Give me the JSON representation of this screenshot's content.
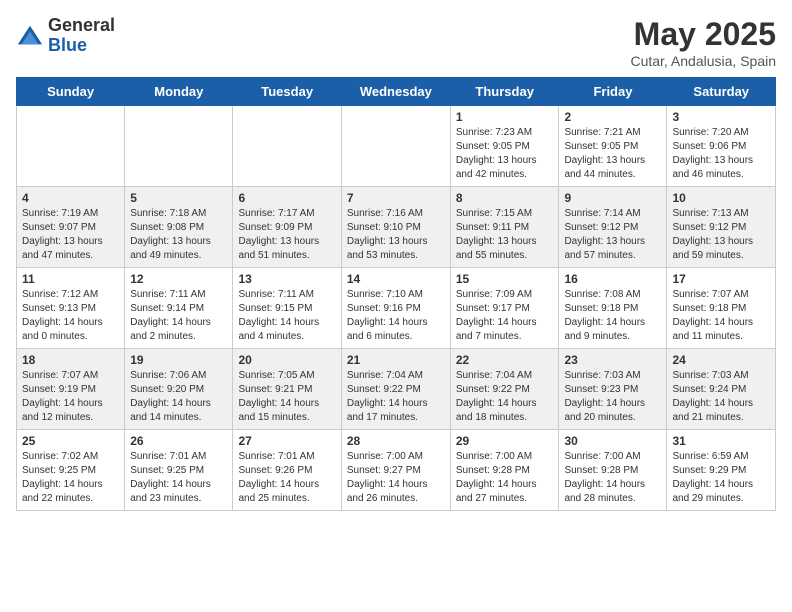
{
  "logo": {
    "general": "General",
    "blue": "Blue"
  },
  "title": {
    "month_year": "May 2025",
    "location": "Cutar, Andalusia, Spain"
  },
  "weekdays": [
    "Sunday",
    "Monday",
    "Tuesday",
    "Wednesday",
    "Thursday",
    "Friday",
    "Saturday"
  ],
  "weeks": [
    [
      {
        "day": "",
        "sunrise": "",
        "sunset": "",
        "daylight": ""
      },
      {
        "day": "",
        "sunrise": "",
        "sunset": "",
        "daylight": ""
      },
      {
        "day": "",
        "sunrise": "",
        "sunset": "",
        "daylight": ""
      },
      {
        "day": "",
        "sunrise": "",
        "sunset": "",
        "daylight": ""
      },
      {
        "day": "1",
        "sunrise": "Sunrise: 7:23 AM",
        "sunset": "Sunset: 9:05 PM",
        "daylight": "Daylight: 13 hours and 42 minutes."
      },
      {
        "day": "2",
        "sunrise": "Sunrise: 7:21 AM",
        "sunset": "Sunset: 9:05 PM",
        "daylight": "Daylight: 13 hours and 44 minutes."
      },
      {
        "day": "3",
        "sunrise": "Sunrise: 7:20 AM",
        "sunset": "Sunset: 9:06 PM",
        "daylight": "Daylight: 13 hours and 46 minutes."
      }
    ],
    [
      {
        "day": "4",
        "sunrise": "Sunrise: 7:19 AM",
        "sunset": "Sunset: 9:07 PM",
        "daylight": "Daylight: 13 hours and 47 minutes."
      },
      {
        "day": "5",
        "sunrise": "Sunrise: 7:18 AM",
        "sunset": "Sunset: 9:08 PM",
        "daylight": "Daylight: 13 hours and 49 minutes."
      },
      {
        "day": "6",
        "sunrise": "Sunrise: 7:17 AM",
        "sunset": "Sunset: 9:09 PM",
        "daylight": "Daylight: 13 hours and 51 minutes."
      },
      {
        "day": "7",
        "sunrise": "Sunrise: 7:16 AM",
        "sunset": "Sunset: 9:10 PM",
        "daylight": "Daylight: 13 hours and 53 minutes."
      },
      {
        "day": "8",
        "sunrise": "Sunrise: 7:15 AM",
        "sunset": "Sunset: 9:11 PM",
        "daylight": "Daylight: 13 hours and 55 minutes."
      },
      {
        "day": "9",
        "sunrise": "Sunrise: 7:14 AM",
        "sunset": "Sunset: 9:12 PM",
        "daylight": "Daylight: 13 hours and 57 minutes."
      },
      {
        "day": "10",
        "sunrise": "Sunrise: 7:13 AM",
        "sunset": "Sunset: 9:12 PM",
        "daylight": "Daylight: 13 hours and 59 minutes."
      }
    ],
    [
      {
        "day": "11",
        "sunrise": "Sunrise: 7:12 AM",
        "sunset": "Sunset: 9:13 PM",
        "daylight": "Daylight: 14 hours and 0 minutes."
      },
      {
        "day": "12",
        "sunrise": "Sunrise: 7:11 AM",
        "sunset": "Sunset: 9:14 PM",
        "daylight": "Daylight: 14 hours and 2 minutes."
      },
      {
        "day": "13",
        "sunrise": "Sunrise: 7:11 AM",
        "sunset": "Sunset: 9:15 PM",
        "daylight": "Daylight: 14 hours and 4 minutes."
      },
      {
        "day": "14",
        "sunrise": "Sunrise: 7:10 AM",
        "sunset": "Sunset: 9:16 PM",
        "daylight": "Daylight: 14 hours and 6 minutes."
      },
      {
        "day": "15",
        "sunrise": "Sunrise: 7:09 AM",
        "sunset": "Sunset: 9:17 PM",
        "daylight": "Daylight: 14 hours and 7 minutes."
      },
      {
        "day": "16",
        "sunrise": "Sunrise: 7:08 AM",
        "sunset": "Sunset: 9:18 PM",
        "daylight": "Daylight: 14 hours and 9 minutes."
      },
      {
        "day": "17",
        "sunrise": "Sunrise: 7:07 AM",
        "sunset": "Sunset: 9:18 PM",
        "daylight": "Daylight: 14 hours and 11 minutes."
      }
    ],
    [
      {
        "day": "18",
        "sunrise": "Sunrise: 7:07 AM",
        "sunset": "Sunset: 9:19 PM",
        "daylight": "Daylight: 14 hours and 12 minutes."
      },
      {
        "day": "19",
        "sunrise": "Sunrise: 7:06 AM",
        "sunset": "Sunset: 9:20 PM",
        "daylight": "Daylight: 14 hours and 14 minutes."
      },
      {
        "day": "20",
        "sunrise": "Sunrise: 7:05 AM",
        "sunset": "Sunset: 9:21 PM",
        "daylight": "Daylight: 14 hours and 15 minutes."
      },
      {
        "day": "21",
        "sunrise": "Sunrise: 7:04 AM",
        "sunset": "Sunset: 9:22 PM",
        "daylight": "Daylight: 14 hours and 17 minutes."
      },
      {
        "day": "22",
        "sunrise": "Sunrise: 7:04 AM",
        "sunset": "Sunset: 9:22 PM",
        "daylight": "Daylight: 14 hours and 18 minutes."
      },
      {
        "day": "23",
        "sunrise": "Sunrise: 7:03 AM",
        "sunset": "Sunset: 9:23 PM",
        "daylight": "Daylight: 14 hours and 20 minutes."
      },
      {
        "day": "24",
        "sunrise": "Sunrise: 7:03 AM",
        "sunset": "Sunset: 9:24 PM",
        "daylight": "Daylight: 14 hours and 21 minutes."
      }
    ],
    [
      {
        "day": "25",
        "sunrise": "Sunrise: 7:02 AM",
        "sunset": "Sunset: 9:25 PM",
        "daylight": "Daylight: 14 hours and 22 minutes."
      },
      {
        "day": "26",
        "sunrise": "Sunrise: 7:01 AM",
        "sunset": "Sunset: 9:25 PM",
        "daylight": "Daylight: 14 hours and 23 minutes."
      },
      {
        "day": "27",
        "sunrise": "Sunrise: 7:01 AM",
        "sunset": "Sunset: 9:26 PM",
        "daylight": "Daylight: 14 hours and 25 minutes."
      },
      {
        "day": "28",
        "sunrise": "Sunrise: 7:00 AM",
        "sunset": "Sunset: 9:27 PM",
        "daylight": "Daylight: 14 hours and 26 minutes."
      },
      {
        "day": "29",
        "sunrise": "Sunrise: 7:00 AM",
        "sunset": "Sunset: 9:28 PM",
        "daylight": "Daylight: 14 hours and 27 minutes."
      },
      {
        "day": "30",
        "sunrise": "Sunrise: 7:00 AM",
        "sunset": "Sunset: 9:28 PM",
        "daylight": "Daylight: 14 hours and 28 minutes."
      },
      {
        "day": "31",
        "sunrise": "Sunrise: 6:59 AM",
        "sunset": "Sunset: 9:29 PM",
        "daylight": "Daylight: 14 hours and 29 minutes."
      }
    ]
  ]
}
